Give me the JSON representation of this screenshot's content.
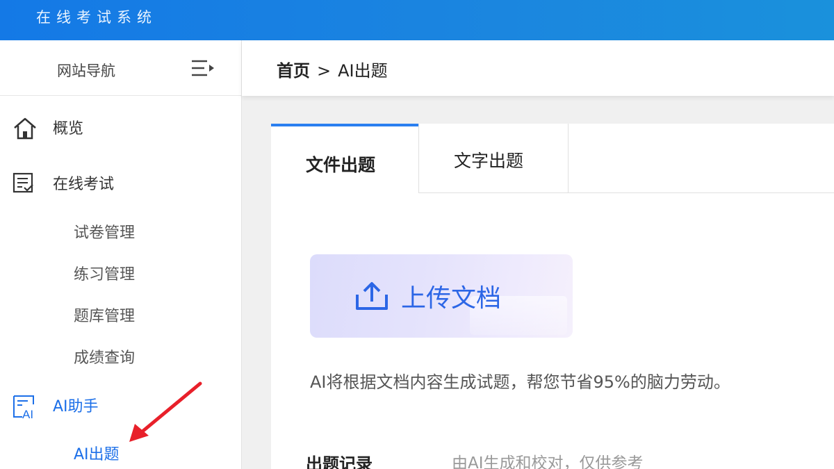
{
  "app": {
    "title": "在线考试系统"
  },
  "sidebar": {
    "header_title": "网站导航",
    "menu": [
      {
        "label": "概览"
      },
      {
        "label": "在线考试",
        "children": [
          "试卷管理",
          "练习管理",
          "题库管理",
          "成绩查询"
        ]
      },
      {
        "label": "AI助手",
        "children": [
          "AI出题"
        ]
      }
    ]
  },
  "breadcrumb": {
    "home": "首页",
    "separator": ">",
    "current": "AI出题"
  },
  "tabs": {
    "file": "文件出题",
    "text": "文字出题"
  },
  "upload": {
    "label": "上传文档"
  },
  "hint": "AI将根据文档内容生成试题，帮您节省95%的脑力劳动。",
  "records": {
    "title": "出题记录",
    "note": "由AI生成和校对，仅供参考"
  },
  "colors": {
    "accent": "#1c6fe8",
    "topbar": "#1479e6",
    "annotation_arrow": "#e8202a"
  }
}
